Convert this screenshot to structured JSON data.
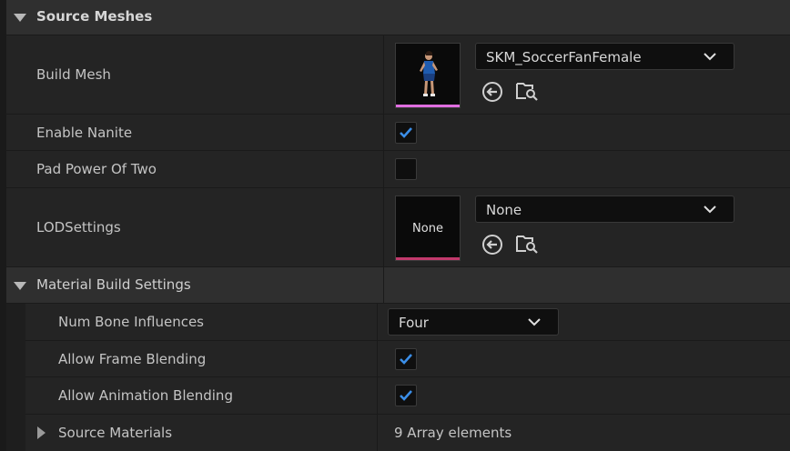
{
  "source_meshes": {
    "title": "Source Meshes",
    "build_mesh": {
      "label": "Build Mesh",
      "value": "SKM_SoccerFanFemale"
    },
    "enable_nanite": {
      "label": "Enable Nanite",
      "checked": true
    },
    "pad_power_of_two": {
      "label": "Pad Power Of Two",
      "checked": false
    },
    "lod_settings": {
      "label": "LODSettings",
      "thumbnail_text": "None",
      "value": "None"
    }
  },
  "material_build_settings": {
    "title": "Material Build Settings",
    "num_bone_influences": {
      "label": "Num Bone Influences",
      "value": "Four"
    },
    "allow_frame_blending": {
      "label": "Allow Frame Blending",
      "checked": true
    },
    "allow_animation_blending": {
      "label": "Allow Animation Blending",
      "checked": true
    },
    "source_materials": {
      "label": "Source Materials",
      "value": "9 Array elements"
    }
  },
  "colors": {
    "checkbox_check": "#3b8ee8",
    "skeletal_mesh_bar": "#e06ee0",
    "lod_bar": "#c2396c"
  },
  "icons": [
    "use-selected-asset-icon",
    "browse-asset-icon",
    "combo-arrow-icon",
    "expand-arrow-icon",
    "collapse-arrow-icon"
  ]
}
